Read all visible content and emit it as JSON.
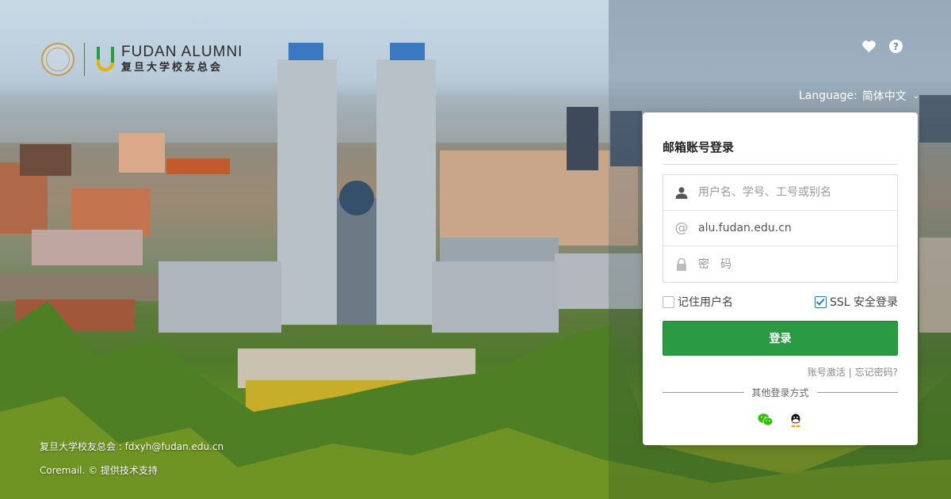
{
  "brand": {
    "name_en": "FUDAN ALUMNI",
    "name_cn": "复旦大学校友总会"
  },
  "header": {
    "language_label": "Language:",
    "language_value": "简体中文",
    "icons": [
      "heart-icon",
      "help-icon"
    ]
  },
  "login": {
    "title": "邮箱账号登录",
    "username_placeholder": "用户名、学号、工号或别名",
    "domain": "alu.fudan.edu.cn",
    "password_placeholder": "密　码",
    "remember_label": "记住用户名",
    "remember_checked": false,
    "ssl_label": "SSL 安全登录",
    "ssl_checked": true,
    "submit_label": "登录",
    "activate_link": "账号激活",
    "link_separator": "|",
    "forgot_link": "忘记密码?",
    "other_methods_label": "其他登录方式",
    "social": [
      "wechat-icon",
      "qq-icon"
    ]
  },
  "footer": {
    "contact": "复旦大学校友总会 : fdxyh@fudan.edu.cn",
    "powered_by": "Coremail. © 提供技术支持"
  },
  "colors": {
    "primary_button": "#2a9a44",
    "checkbox_accent": "#2f78c4",
    "wechat": "#2dc100"
  }
}
